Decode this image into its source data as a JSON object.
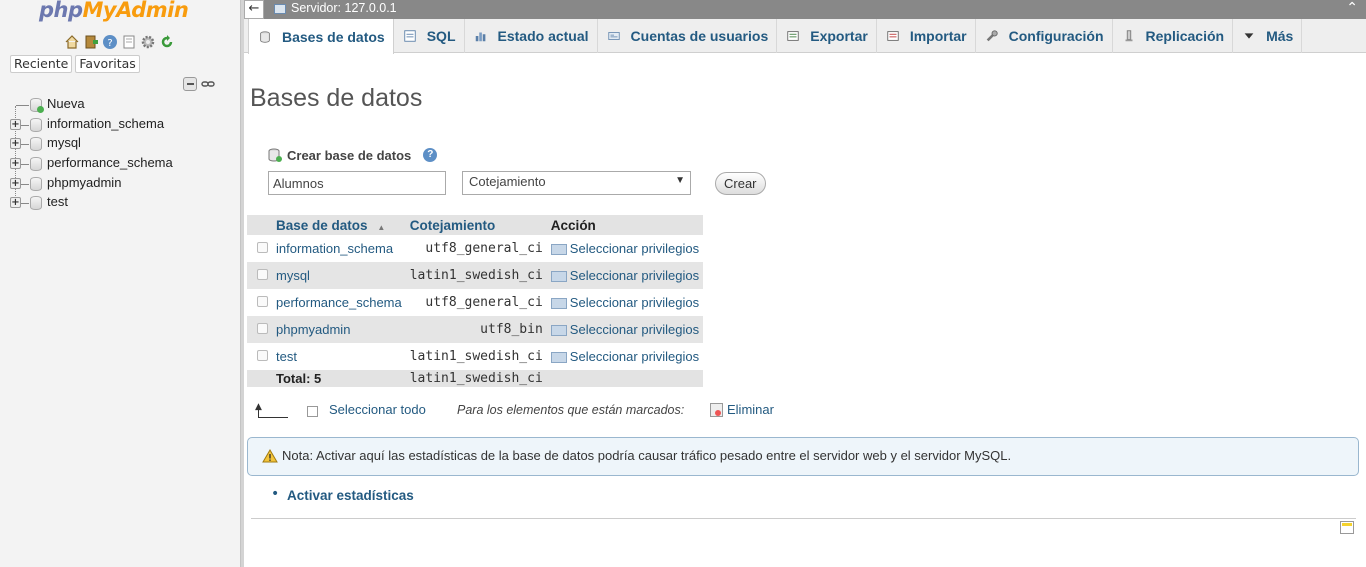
{
  "nav": {
    "logo_php": "php",
    "logo_myadmin": "MyAdmin",
    "quick_icons": [
      "home-icon",
      "exit-icon",
      "help-icon",
      "docs-icon",
      "settings-icon",
      "reload-icon"
    ],
    "tabs": [
      "Reciente",
      "Favoritas"
    ],
    "tree": [
      {
        "label": "Nueva",
        "kind": "new"
      },
      {
        "label": "information_schema",
        "kind": "db"
      },
      {
        "label": "mysql",
        "kind": "db"
      },
      {
        "label": "performance_schema",
        "kind": "db"
      },
      {
        "label": "phpmyadmin",
        "kind": "db"
      },
      {
        "label": "test",
        "kind": "db"
      }
    ]
  },
  "serverbar": {
    "back": "←",
    "label": "Servidor: 127.0.0.1",
    "collapse": "⌃"
  },
  "menu": {
    "tabs": [
      {
        "label": "Bases de datos",
        "icon": "database-icon",
        "active": true
      },
      {
        "label": "SQL",
        "icon": "sql-icon",
        "active": false
      },
      {
        "label": "Estado actual",
        "icon": "status-icon",
        "active": false
      },
      {
        "label": "Cuentas de usuarios",
        "icon": "users-icon",
        "active": false
      },
      {
        "label": "Exportar",
        "icon": "export-icon",
        "active": false
      },
      {
        "label": "Importar",
        "icon": "import-icon",
        "active": false
      },
      {
        "label": "Configuración",
        "icon": "wrench-icon",
        "active": false
      },
      {
        "label": "Replicación",
        "icon": "replication-icon",
        "active": false
      },
      {
        "label": "Más",
        "icon": "caret-down-icon",
        "active": false
      }
    ]
  },
  "main": {
    "title": "Bases de datos",
    "create": {
      "heading": "Crear base de datos",
      "db_name_value": "Alumnos",
      "collation_value": "Cotejamiento",
      "button": "Crear"
    },
    "table": {
      "headers": {
        "name": "Base de datos",
        "collation": "Cotejamiento",
        "action": "Acción"
      },
      "rows": [
        {
          "name": "information_schema",
          "collation": "utf8_general_ci",
          "action": "Seleccionar privilegios"
        },
        {
          "name": "mysql",
          "collation": "latin1_swedish_ci",
          "action": "Seleccionar privilegios"
        },
        {
          "name": "performance_schema",
          "collation": "utf8_general_ci",
          "action": "Seleccionar privilegios"
        },
        {
          "name": "phpmyadmin",
          "collation": "utf8_bin",
          "action": "Seleccionar privilegios"
        },
        {
          "name": "test",
          "collation": "latin1_swedish_ci",
          "action": "Seleccionar privilegios"
        }
      ],
      "total_label": "Total: 5",
      "total_collation": "latin1_swedish_ci"
    },
    "bulk": {
      "select_all": "Seleccionar todo",
      "marked": "Para los elementos que están marcados:",
      "delete": "Eliminar"
    },
    "note": "Nota: Activar aquí las estadísticas de la base de datos podría causar tráfico pesado entre el servidor web y el servidor MySQL.",
    "stats_link": "Activar estadísticas"
  },
  "colors": {
    "link": "#235a81",
    "logo_php": "#6c78af",
    "logo_myadmin": "#f89c0e",
    "serverbar": "#888888"
  }
}
